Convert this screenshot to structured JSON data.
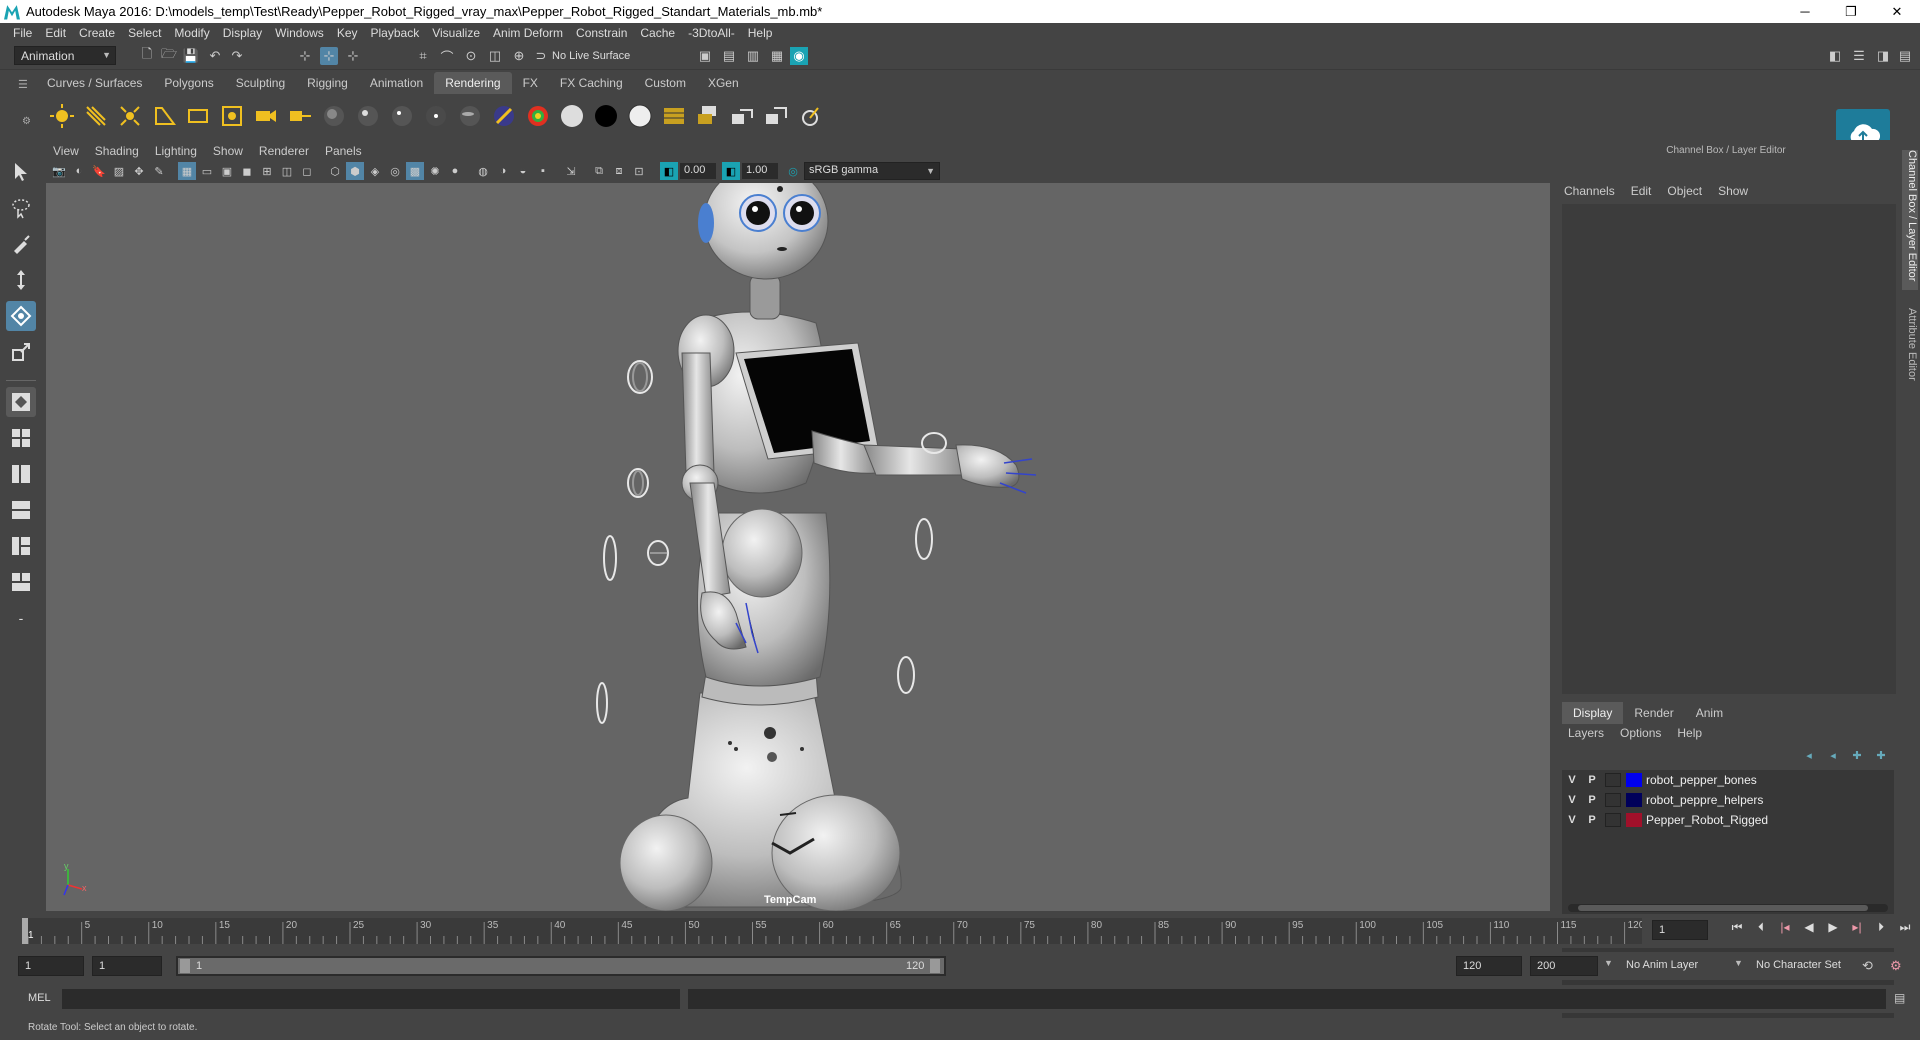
{
  "window": {
    "title": "Autodesk Maya 2016: D:\\models_temp\\Test\\Ready\\Pepper_Robot_Rigged_vray_max\\Pepper_Robot_Rigged_Standart_Materials_mb.mb*",
    "minimize": "─",
    "restore": "❐",
    "close": "✕"
  },
  "menubar": [
    "File",
    "Edit",
    "Create",
    "Select",
    "Modify",
    "Display",
    "Windows",
    "Key",
    "Playback",
    "Visualize",
    "Anim Deform",
    "Constrain",
    "Cache",
    "-3DtoAll-",
    "Help"
  ],
  "status_line": {
    "menu_set": "Animation",
    "live_surface": "No Live Surface"
  },
  "shelf_tabs": [
    "Curves / Surfaces",
    "Polygons",
    "Sculpting",
    "Rigging",
    "Animation",
    "Rendering",
    "FX",
    "FX Caching",
    "Custom",
    "XGen"
  ],
  "shelf_active_tab": "Rendering",
  "viewport": {
    "menus": [
      "View",
      "Shading",
      "Lighting",
      "Show",
      "Renderer",
      "Panels"
    ],
    "exposure": "0.00",
    "gamma": "1.00",
    "color_space": "sRGB gamma",
    "camera_label": "TempCam",
    "axis_x": "x",
    "axis_y": "y"
  },
  "channel_box": {
    "header": "Channel Box / Layer Editor",
    "menus": [
      "Channels",
      "Edit",
      "Object",
      "Show"
    ]
  },
  "layer_editor": {
    "tabs": [
      "Display",
      "Render",
      "Anim"
    ],
    "active_tab": "Display",
    "menus": [
      "Layers",
      "Options",
      "Help"
    ],
    "layers": [
      {
        "v": "V",
        "p": "P",
        "name": "robot_pepper_bones",
        "color": "#0000ee"
      },
      {
        "v": "V",
        "p": "P",
        "name": "robot_peppre_helpers",
        "color": "#00005a"
      },
      {
        "v": "V",
        "p": "P",
        "name": "Pepper_Robot_Rigged",
        "color": "#a0102a"
      }
    ]
  },
  "side_tabs": {
    "channel_box": "Channel Box / Layer Editor",
    "attribute_editor": "Attribute Editor"
  },
  "timeline": {
    "ticks": [
      "5",
      "10",
      "15",
      "20",
      "25",
      "30",
      "35",
      "40",
      "45",
      "50",
      "55",
      "60",
      "65",
      "70",
      "75",
      "80",
      "85",
      "90",
      "95",
      "100",
      "105",
      "110",
      "115",
      "120"
    ],
    "start_label": "1",
    "current_frame": "1"
  },
  "range": {
    "start": "1",
    "playback_start": "1",
    "slider_start": "1",
    "slider_end": "120",
    "playback_end": "120",
    "end": "200",
    "anim_layer": "No Anim Layer",
    "character_set": "No Character Set"
  },
  "command_line": {
    "lang": "MEL"
  },
  "help_line": "Rotate Tool: Select an object to rotate.",
  "colors": {
    "accent": "#5285a6",
    "maya_teal": "#1aa3b3",
    "viewport_bg": "#656565"
  }
}
